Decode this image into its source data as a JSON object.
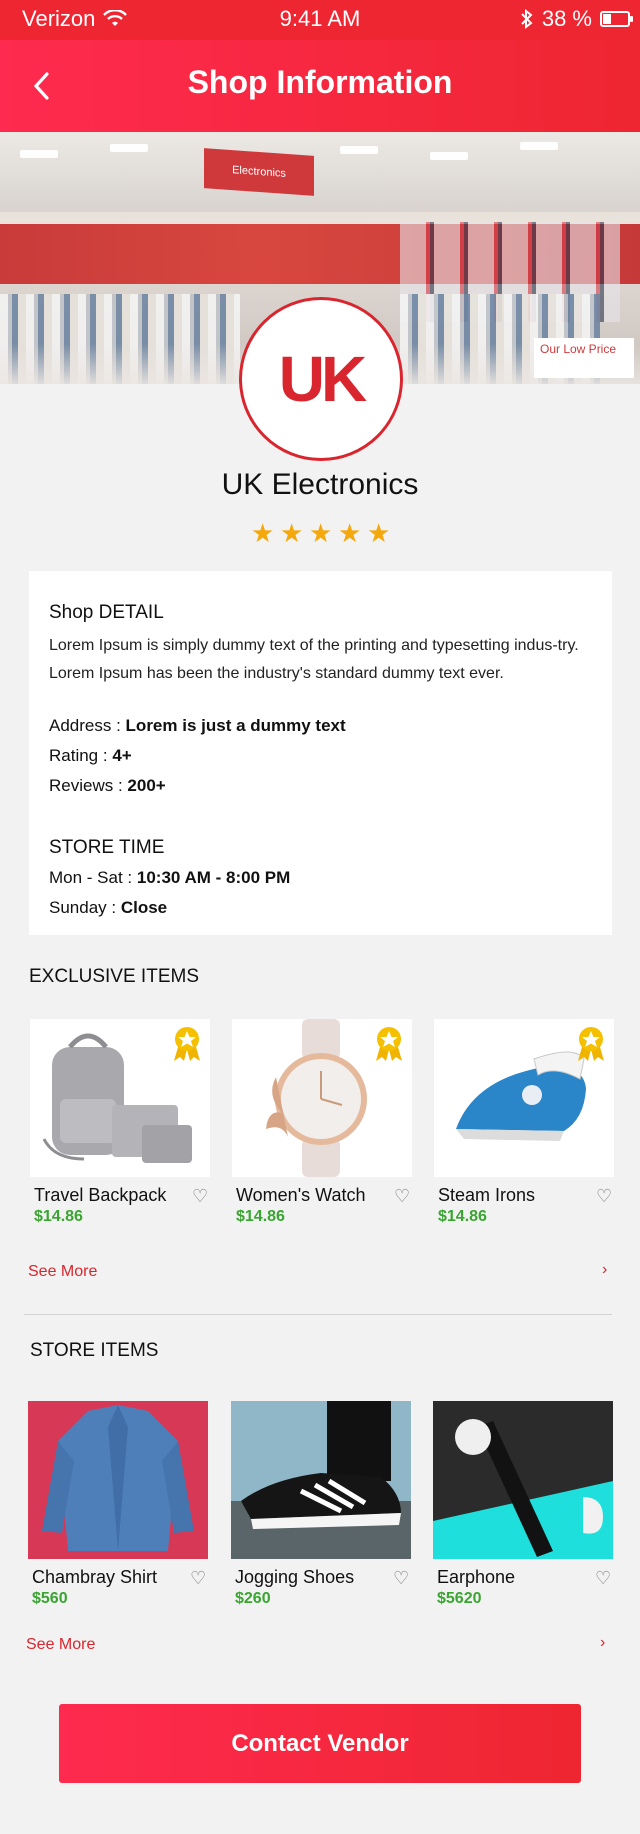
{
  "status_bar": {
    "carrier": "Verizon",
    "time": "9:41 AM",
    "battery": "38 %",
    "battery_level": 0.38
  },
  "nav": {
    "title": "Shop Information"
  },
  "shop": {
    "logo_text": "UK",
    "name": "UK Electronics",
    "rating_stars": 5
  },
  "banner": {
    "sign": "Electronics",
    "promo": "Our Low Price"
  },
  "detail": {
    "heading": "Shop DETAIL",
    "description": "Lorem Ipsum is simply dummy text of the printing and typesetting indus-try. Lorem Ipsum has been the industry's standard dummy text ever.",
    "address_label": "Address : ",
    "address_value": "Lorem is just a dummy text",
    "rating_label": "Rating : ",
    "rating_value": "4+",
    "reviews_label": "Reviews : ",
    "reviews_value": "200+",
    "store_time_heading": "STORE TIME",
    "weekday_label": "Mon - Sat : ",
    "weekday_value": "10:30 AM - 8:00 PM",
    "sunday_label": "Sunday : ",
    "sunday_value": "Close"
  },
  "exclusive": {
    "title": "EXCLUSIVE ITEMS",
    "items": [
      {
        "name": "Travel Backpack",
        "price": "$14.86"
      },
      {
        "name": "Women's Watch",
        "price": "$14.86"
      },
      {
        "name": "Steam Irons",
        "price": "$14.86"
      }
    ],
    "see_more": "See More",
    "arrow": "›"
  },
  "store": {
    "title": "STORE ITEMS",
    "items": [
      {
        "name": "Chambray Shirt",
        "price": "$560"
      },
      {
        "name": "Jogging Shoes",
        "price": "$260"
      },
      {
        "name": "Earphone",
        "price": "$5620"
      }
    ],
    "see_more": "See More",
    "arrow": "›"
  },
  "contact_button": "Contact Vendor",
  "colors": {
    "brand_red": "#ee2631",
    "price_green": "#3aa531",
    "star_gold": "#f5a80b"
  }
}
